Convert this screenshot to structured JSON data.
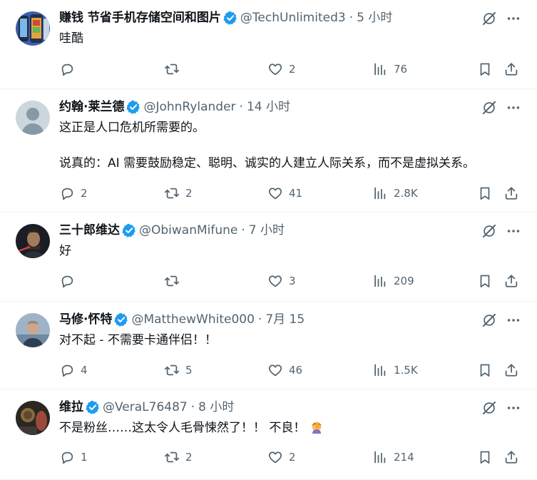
{
  "colors": {
    "text": "#0f1419",
    "secondary": "#536471",
    "verified": "#1d9bf0",
    "divider": "#eff3f4"
  },
  "tweets": [
    {
      "name": "赚钱 节省手机存储空间和图片",
      "handle": "@TechUnlimited3",
      "time": "5 小时",
      "body": [
        "哇酷"
      ],
      "replies": "",
      "retweets": "",
      "likes": "2",
      "views": "76",
      "avatar": "phone-collage"
    },
    {
      "name": "约翰·莱兰德",
      "handle": "@JohnRylander",
      "time": "14 小时",
      "body": [
        "这正是人口危机所需要的。",
        "说真的：AI 需要鼓励稳定、聪明、诚实的人建立人际关系，而不是虚拟关系。"
      ],
      "replies": "2",
      "retweets": "2",
      "likes": "41",
      "views": "2.8K",
      "avatar": "default-silhouette"
    },
    {
      "name": "三十郎维达",
      "handle": "@ObiwanMifune",
      "time": "7 小时",
      "body": [
        "好"
      ],
      "replies": "",
      "retweets": "",
      "likes": "3",
      "views": "209",
      "avatar": "dark-warrior"
    },
    {
      "name": "马修·怀特",
      "handle": "@MatthewWhite000",
      "time": "7月 15",
      "body": [
        "对不起 - 不需要卡通伴侣！！"
      ],
      "replies": "4",
      "retweets": "5",
      "likes": "46",
      "views": "1.5K",
      "avatar": "man-photo"
    },
    {
      "name": "维拉",
      "handle": "@VeraL76487",
      "time": "8 小时",
      "body": [
        "不是粉丝……这太令人毛骨悚然了！！ 不良！"
      ],
      "replies": "1",
      "retweets": "2",
      "likes": "2",
      "views": "214",
      "avatar": "dark-photo",
      "emoji": "face-palm-emoji"
    }
  ],
  "separator": "·"
}
